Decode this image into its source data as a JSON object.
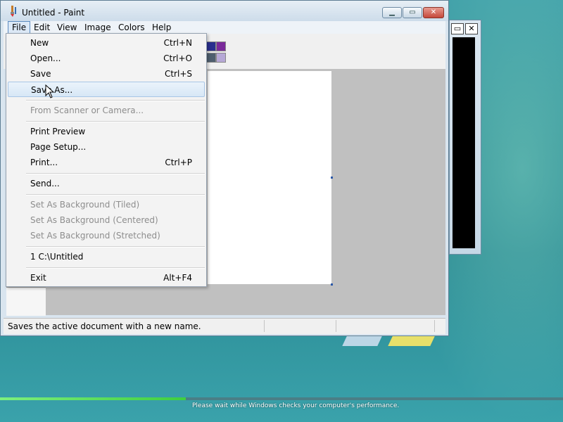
{
  "window": {
    "title": "Untitled - Paint",
    "icon": "paint-brush-icon",
    "controls": {
      "minimize_icon": "minimize-icon",
      "maximize_icon": "maximize-icon",
      "close_icon": "close-icon"
    }
  },
  "menubar": {
    "items": [
      {
        "label": "File",
        "active": true
      },
      {
        "label": "Edit"
      },
      {
        "label": "View"
      },
      {
        "label": "Image"
      },
      {
        "label": "Colors"
      },
      {
        "label": "Help"
      }
    ]
  },
  "file_menu": {
    "items": [
      {
        "label": "New",
        "shortcut": "Ctrl+N"
      },
      {
        "label": "Open...",
        "shortcut": "Ctrl+O"
      },
      {
        "label": "Save",
        "shortcut": "Ctrl+S"
      },
      {
        "label": "Save As...",
        "shortcut": "",
        "highlighted": true
      },
      {
        "label": "From Scanner or Camera...",
        "shortcut": "",
        "disabled": true
      },
      {
        "label": "Print Preview",
        "shortcut": ""
      },
      {
        "label": "Page Setup...",
        "shortcut": ""
      },
      {
        "label": "Print...",
        "shortcut": "Ctrl+P"
      },
      {
        "label": "Send...",
        "shortcut": ""
      },
      {
        "label": "Set As Background (Tiled)",
        "shortcut": "",
        "disabled": true
      },
      {
        "label": "Set As Background (Centered)",
        "shortcut": "",
        "disabled": true
      },
      {
        "label": "Set As Background (Stretched)",
        "shortcut": "",
        "disabled": true
      },
      {
        "label": "1 C:\\Untitled",
        "shortcut": ""
      },
      {
        "label": "Exit",
        "shortcut": "Alt+F4"
      }
    ]
  },
  "palette": {
    "colors": [
      "#2a2f8f",
      "#7a2a9a",
      "#4f5f6f",
      "#b6a8d6"
    ]
  },
  "statusbar": {
    "text": "Saves the active document with a new name."
  },
  "background_window": {
    "maximize_icon": "maximize-icon",
    "close_icon": "close-icon"
  },
  "progress": {
    "fraction": 0.33,
    "text": "Please wait while Windows checks your computer's performance."
  }
}
